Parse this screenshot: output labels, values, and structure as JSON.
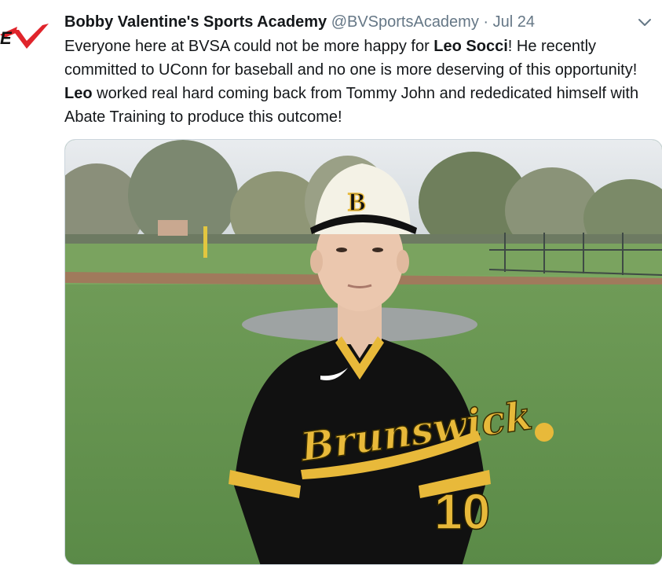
{
  "author": {
    "name": "Bobby Valentine's Sports Academy",
    "handle": "@BVSportsAcademy",
    "separator": "·",
    "date": "Jul 24",
    "avatar_text": "BV"
  },
  "tweet": {
    "segments": [
      {
        "text": "Everyone here at BVSA could not be more happy for ",
        "bold": false
      },
      {
        "text": "Leo Socci",
        "bold": true
      },
      {
        "text": "! He recently committed to UConn for baseball and no one is more deserving of this opportunity! ",
        "bold": false
      },
      {
        "text": "Leo",
        "bold": true
      },
      {
        "text": " worked real hard coming back from Tommy John and rededicated himself with Abate Training to produce this outcome!",
        "bold": false
      }
    ]
  },
  "photo": {
    "cap_letter": "B",
    "jersey_script": "Brunswick",
    "jersey_number": "10"
  },
  "colors": {
    "accent_red": "#e0242b",
    "text_primary": "#14171a",
    "text_secondary": "#657786",
    "jersey_black": "#111111",
    "jersey_gold": "#e8b93a"
  },
  "icons": {
    "menu": "chevron-down-icon",
    "avatar": "bv-logo"
  }
}
